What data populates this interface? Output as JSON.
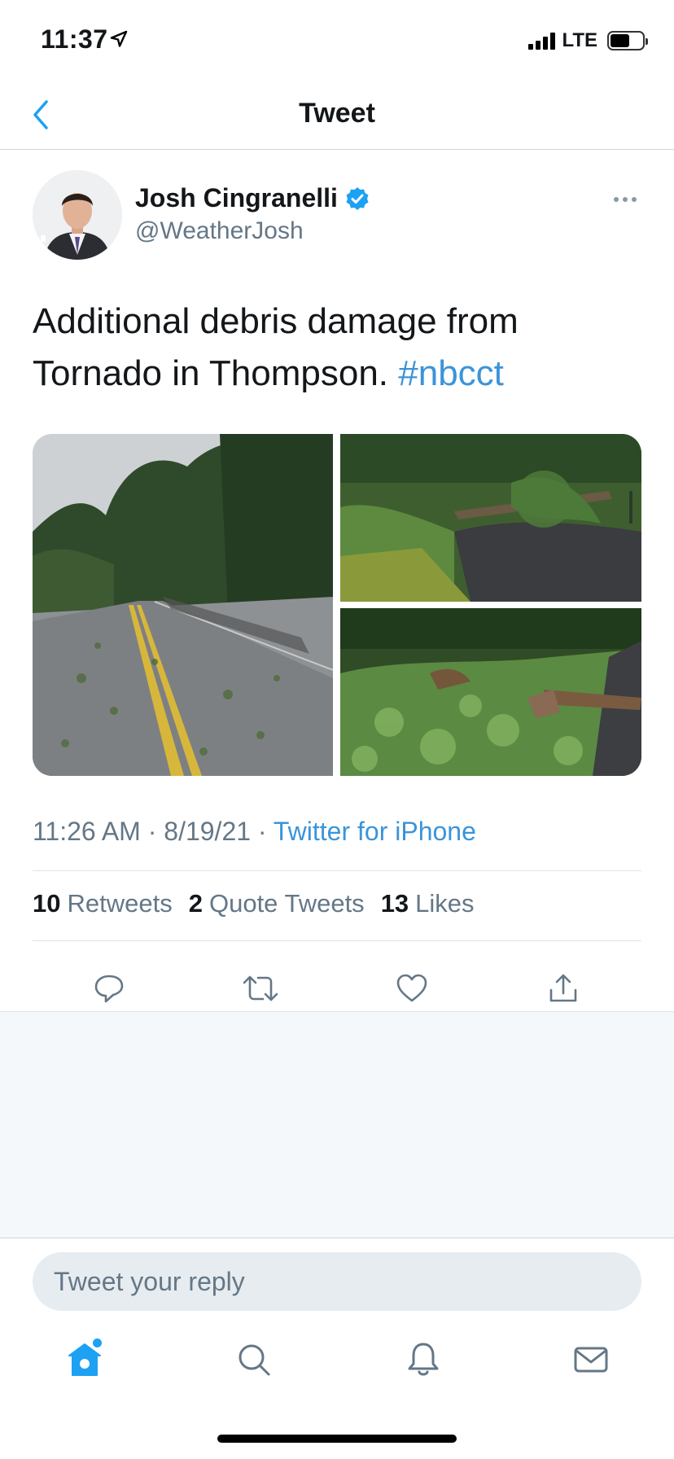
{
  "status_bar": {
    "time": "11:37",
    "network": "LTE",
    "battery_level": 0.6
  },
  "nav": {
    "title": "Tweet",
    "back_icon": "chevron-left-icon"
  },
  "tweet": {
    "author": {
      "display_name": "Josh Cingranelli",
      "handle": "@WeatherJosh",
      "verified": true
    },
    "text": "Additional debris damage from Tornado in Thompson.",
    "hashtag": "#nbcct",
    "timestamp": "11:26 AM · 8/19/21 · ",
    "source": "Twitter for iPhone",
    "stats": {
      "retweets_count": "10",
      "retweets_label": "Retweets",
      "quotes_count": "2",
      "quotes_label": "Quote Tweets",
      "likes_count": "13",
      "likes_label": "Likes"
    },
    "actions": [
      "reply-icon",
      "retweet-icon",
      "like-icon",
      "share-icon"
    ]
  },
  "reply": {
    "placeholder": "Tweet your reply"
  },
  "tab_bar": {
    "items": [
      "home-icon",
      "search-icon",
      "notifications-icon",
      "messages-icon"
    ],
    "active": "home-icon"
  },
  "colors": {
    "accent": "#1da1f2",
    "link": "#3b94d9",
    "secondary_text": "#657786"
  }
}
